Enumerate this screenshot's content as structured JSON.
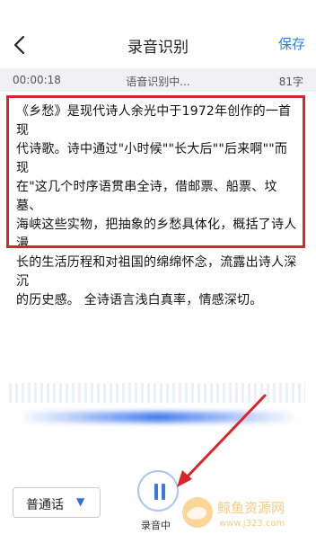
{
  "header": {
    "title": "录音识别",
    "save_label": "保存"
  },
  "status_bar": {
    "elapsed": "00:00:18",
    "status": "语音识别中...",
    "char_count": "81字"
  },
  "transcript": {
    "lines": [
      "《乡愁》是现代诗人余光中于1972年创作的一首现",
      "代诗歌。诗中通过\"小时候\"\"长大后\"\"后来啊\"\"而现",
      "在\"这几个时序语贯串全诗，借邮票、船票、坟墓、",
      "海峡这些实物，把抽象的乡愁具体化，概括了诗人漫",
      "长的生活历程和对祖国的绵绵怀念，流露出诗人深沉",
      "的历史感。 全诗语言浅白真率，情感深切。"
    ]
  },
  "controls": {
    "language": "普通话",
    "recording_label": "录音中"
  },
  "watermark": {
    "text_cn": "鲸鱼资源网",
    "text_url": "www.j323.com"
  },
  "colors": {
    "accent": "#2f7fe8",
    "annotation": "#d9262b"
  }
}
